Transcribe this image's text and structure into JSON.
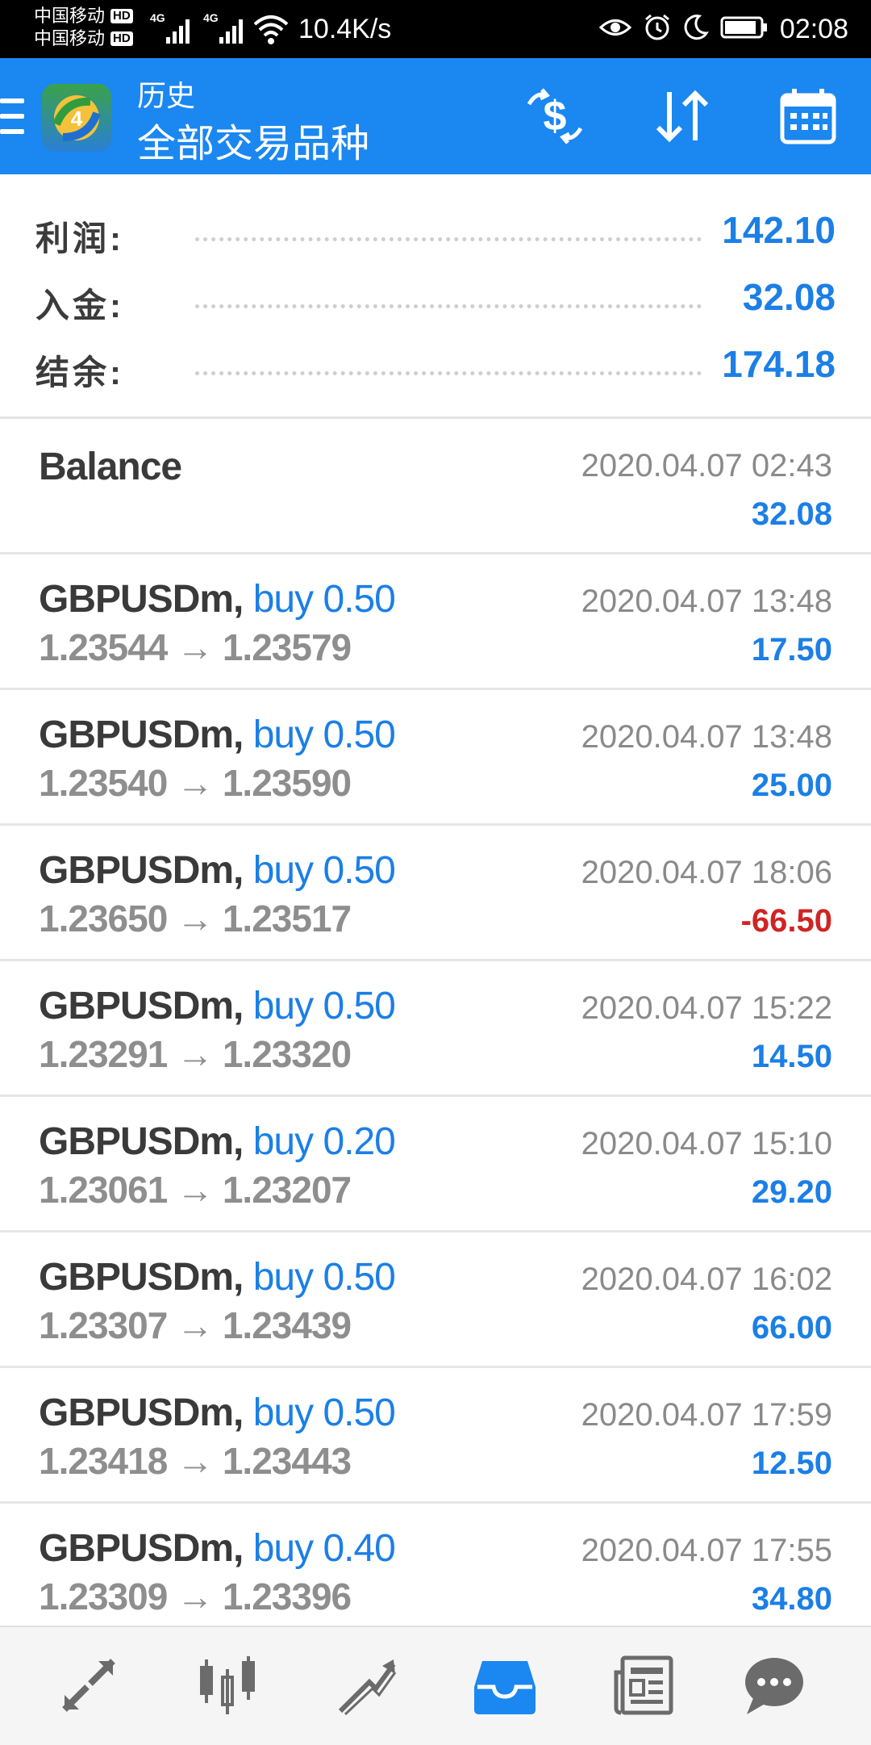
{
  "status_bar": {
    "carrier1": "中国移动",
    "carrier2": "中国移动",
    "hd_badge": "HD",
    "network_label": "4G",
    "net_speed": "10.4K/s",
    "time": "02:08",
    "icons": [
      "eye-icon",
      "alarm-icon",
      "moon-icon",
      "battery-icon"
    ]
  },
  "app_bar": {
    "subtitle": "历史",
    "title": "全部交易品种",
    "accent": "#1b87f0",
    "actions": [
      "currency-exchange-icon",
      "sort-icon",
      "calendar-icon"
    ]
  },
  "summary": {
    "rows": [
      {
        "label": "利润:",
        "value": "142.10"
      },
      {
        "label": "入金:",
        "value": "32.08"
      },
      {
        "label": "结余:",
        "value": "174.18"
      }
    ]
  },
  "history": [
    {
      "symbol": "Balance",
      "side": "",
      "prices": "",
      "time": "2020.04.07 02:43",
      "profit": "32.08"
    },
    {
      "symbol": "GBPUSDm,",
      "side": "buy 0.50",
      "prices": "1.23544 → 1.23579",
      "time": "2020.04.07 13:48",
      "profit": "17.50"
    },
    {
      "symbol": "GBPUSDm,",
      "side": "buy 0.50",
      "prices": "1.23540 → 1.23590",
      "time": "2020.04.07 13:48",
      "profit": "25.00"
    },
    {
      "symbol": "GBPUSDm,",
      "side": "buy 0.50",
      "prices": "1.23650 → 1.23517",
      "time": "2020.04.07 18:06",
      "profit": "-66.50"
    },
    {
      "symbol": "GBPUSDm,",
      "side": "buy 0.50",
      "prices": "1.23291 → 1.23320",
      "time": "2020.04.07 15:22",
      "profit": "14.50"
    },
    {
      "symbol": "GBPUSDm,",
      "side": "buy 0.20",
      "prices": "1.23061 → 1.23207",
      "time": "2020.04.07 15:10",
      "profit": "29.20"
    },
    {
      "symbol": "GBPUSDm,",
      "side": "buy 0.50",
      "prices": "1.23307 → 1.23439",
      "time": "2020.04.07 16:02",
      "profit": "66.00"
    },
    {
      "symbol": "GBPUSDm,",
      "side": "buy 0.50",
      "prices": "1.23418 → 1.23443",
      "time": "2020.04.07 17:59",
      "profit": "12.50"
    },
    {
      "symbol": "GBPUSDm,",
      "side": "buy 0.40",
      "prices": "1.23309 → 1.23396",
      "time": "2020.04.07 17:55",
      "profit": "34.80"
    }
  ],
  "bottom_nav": {
    "items": [
      "quotes-icon",
      "chart-icon",
      "trade-icon",
      "history-icon",
      "news-icon",
      "chat-icon"
    ],
    "active": "history-icon",
    "active_color": "#1b87f0"
  },
  "colors": {
    "positive": "#1b7fe6",
    "negative": "#d02424"
  }
}
